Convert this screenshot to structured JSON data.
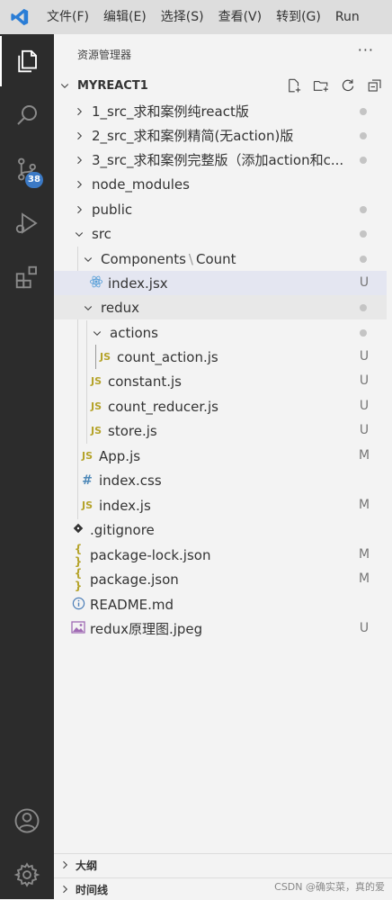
{
  "menubar": {
    "items": [
      "文件(F)",
      "编辑(E)",
      "选择(S)",
      "查看(V)",
      "转到(G)",
      "Run"
    ]
  },
  "activity": {
    "scm_badge": "38",
    "accent_color": "#3b79c5"
  },
  "explorer": {
    "title": "资源管理器",
    "more": "···",
    "root": "MYREACT1",
    "items": [
      {
        "label": "1_src_求和案例纯react版",
        "status": ""
      },
      {
        "label": "2_src_求和案例精简(无action)版",
        "status": ""
      },
      {
        "label": "3_src_求和案例完整版（添加action和c...",
        "status": ""
      },
      {
        "label": "node_modules",
        "status": ""
      },
      {
        "label": "public",
        "status": ""
      },
      {
        "label": "src",
        "status": ""
      },
      {
        "label": "Components",
        "sep": "\\",
        "label2": "Count",
        "status": ""
      },
      {
        "label": "index.jsx",
        "status": "U"
      },
      {
        "label": "redux",
        "status": ""
      },
      {
        "label": "actions",
        "status": ""
      },
      {
        "label": "count_action.js",
        "status": "U"
      },
      {
        "label": "constant.js",
        "status": "U"
      },
      {
        "label": "count_reducer.js",
        "status": "U"
      },
      {
        "label": "store.js",
        "status": "U"
      },
      {
        "label": "App.js",
        "status": "M"
      },
      {
        "label": "index.css",
        "status": ""
      },
      {
        "label": "index.js",
        "status": "M"
      },
      {
        "label": ".gitignore",
        "status": ""
      },
      {
        "label": "package-lock.json",
        "status": "M"
      },
      {
        "label": "package.json",
        "status": "M"
      },
      {
        "label": "README.md",
        "status": ""
      },
      {
        "label": "redux原理图.jpeg",
        "status": "U"
      }
    ],
    "icon_labels": {
      "js": "JS",
      "css": "#",
      "json": "{ }"
    }
  },
  "panels": {
    "outline": "大纲",
    "timeline": "时间线"
  },
  "watermark": "CSDN @确实菜，真的爱"
}
